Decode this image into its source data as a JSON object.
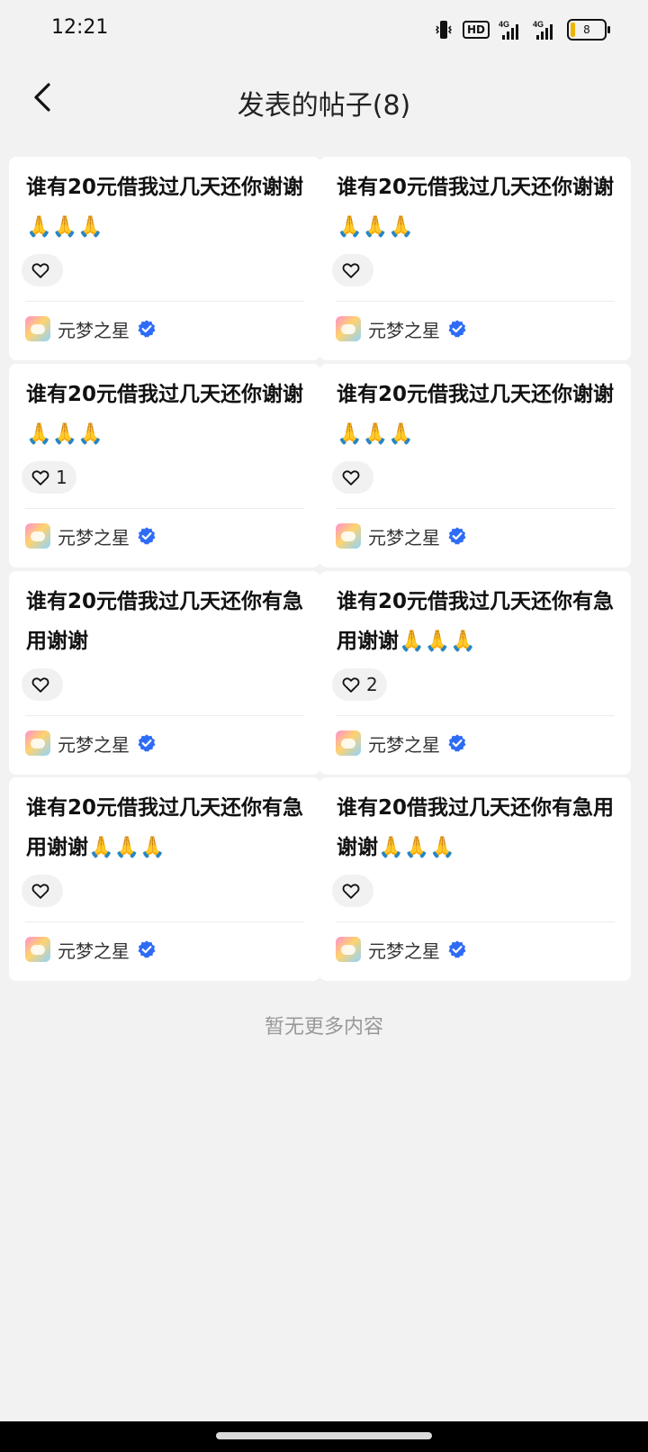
{
  "status": {
    "time": "12:21",
    "battery": "8",
    "hd": "HD",
    "net1": "4G",
    "net2": "4G"
  },
  "header": {
    "title": "发表的帖子(8)"
  },
  "posts": [
    {
      "text": "谁有20元借我过几天还你谢谢🙏🙏🙏",
      "likes": "",
      "author": "元梦之星"
    },
    {
      "text": "谁有20元借我过几天还你谢谢🙏🙏🙏",
      "likes": "",
      "author": "元梦之星"
    },
    {
      "text": "谁有20元借我过几天还你谢谢🙏🙏🙏",
      "likes": "1",
      "author": "元梦之星"
    },
    {
      "text": "谁有20元借我过几天还你谢谢🙏🙏🙏",
      "likes": "",
      "author": "元梦之星"
    },
    {
      "text": "谁有20元借我过几天还你有急用谢谢",
      "likes": "",
      "author": "元梦之星"
    },
    {
      "text": "谁有20元借我过几天还你有急用谢谢🙏🙏🙏",
      "likes": "2",
      "author": "元梦之星"
    },
    {
      "text": "谁有20元借我过几天还你有急用谢谢🙏🙏🙏",
      "likes": "",
      "author": "元梦之星"
    },
    {
      "text": "谁有20借我过几天还你有急用谢谢🙏🙏🙏",
      "likes": "",
      "author": "元梦之星"
    }
  ],
  "footer": {
    "end_text": "暂无更多内容"
  },
  "colors": {
    "verified": "#2f6cf6",
    "background": "#f2f2f2",
    "battery": "#f0b400"
  }
}
